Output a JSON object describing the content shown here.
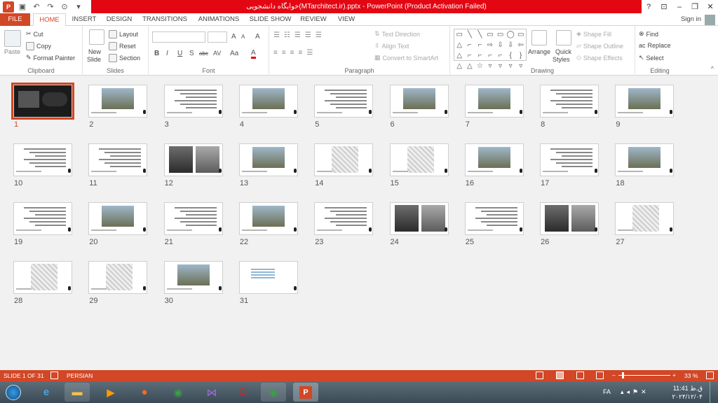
{
  "window": {
    "title": "خوابگاه دانشجویی(MTarchitect.ir).pptx - PowerPoint (Product Activation Failed)",
    "help": "?",
    "restore_ribbon": "⊡",
    "minimize": "–",
    "maximize": "❐",
    "close": "✕"
  },
  "qat": {
    "save_icon": "save-icon",
    "undo_icon": "undo-icon",
    "redo_icon": "redo-icon",
    "present_icon": "present-icon"
  },
  "tabs": [
    "FILE",
    "HOME",
    "INSERT",
    "DESIGN",
    "TRANSITIONS",
    "ANIMATIONS",
    "SLIDE SHOW",
    "REVIEW",
    "VIEW"
  ],
  "signin": "Sign in",
  "ribbon": {
    "clipboard": {
      "label": "Clipboard",
      "paste": "Paste",
      "cut": "Cut",
      "copy": "Copy",
      "format_painter": "Format Painter"
    },
    "slides": {
      "label": "Slides",
      "new_slide": "New",
      "new_slide2": "Slide",
      "layout": "Layout",
      "reset": "Reset",
      "section": "Section"
    },
    "font": {
      "label": "Font",
      "bold": "B",
      "italic": "I",
      "underline": "U",
      "shadow": "S",
      "strike": "abc",
      "spacing": "AV",
      "case": "Aa",
      "color": "A",
      "grow": "A",
      "shrink": "A",
      "clear": "A"
    },
    "paragraph": {
      "label": "Paragraph",
      "text_direction": "Text Direction",
      "align_text": "Align Text",
      "convert_smartart": "Convert to SmartArt"
    },
    "drawing": {
      "label": "Drawing",
      "arrange": "Arrange",
      "quick": "Quick",
      "styles": "Styles",
      "shape_fill": "Shape Fill",
      "shape_outline": "Shape Outline",
      "shape_effects": "Shape Effects",
      "shapes": [
        "▭",
        "╲",
        "╲",
        "▭",
        "▭",
        "◯",
        "▭",
        "△",
        "⌐",
        "⌐",
        "⇨",
        "⇩",
        "⇩",
        "⇦",
        "△",
        "⌐",
        "⌐",
        "⌐",
        "⌐",
        "{",
        "}",
        "△",
        "△",
        "☆",
        "▿",
        "▿",
        "▿",
        "▿"
      ]
    },
    "editing": {
      "label": "Editing",
      "find": "Find",
      "replace": "Replace",
      "select": "Select"
    }
  },
  "slides": [
    "1",
    "2",
    "3",
    "4",
    "5",
    "6",
    "7",
    "8",
    "9",
    "10",
    "11",
    "12",
    "13",
    "14",
    "15",
    "16",
    "17",
    "18",
    "19",
    "20",
    "21",
    "22",
    "23",
    "24",
    "25",
    "26",
    "27",
    "28",
    "29",
    "30",
    "31"
  ],
  "status": {
    "slide": "SLIDE 1 OF 31",
    "language": "PERSIAN",
    "zoom": "33 %",
    "minus": "–",
    "plus": "+"
  },
  "taskbar": {
    "lang": "FA",
    "time": "11:41 ق.ظ",
    "date": "۲۰۲۴/۱۲/۰۴"
  }
}
